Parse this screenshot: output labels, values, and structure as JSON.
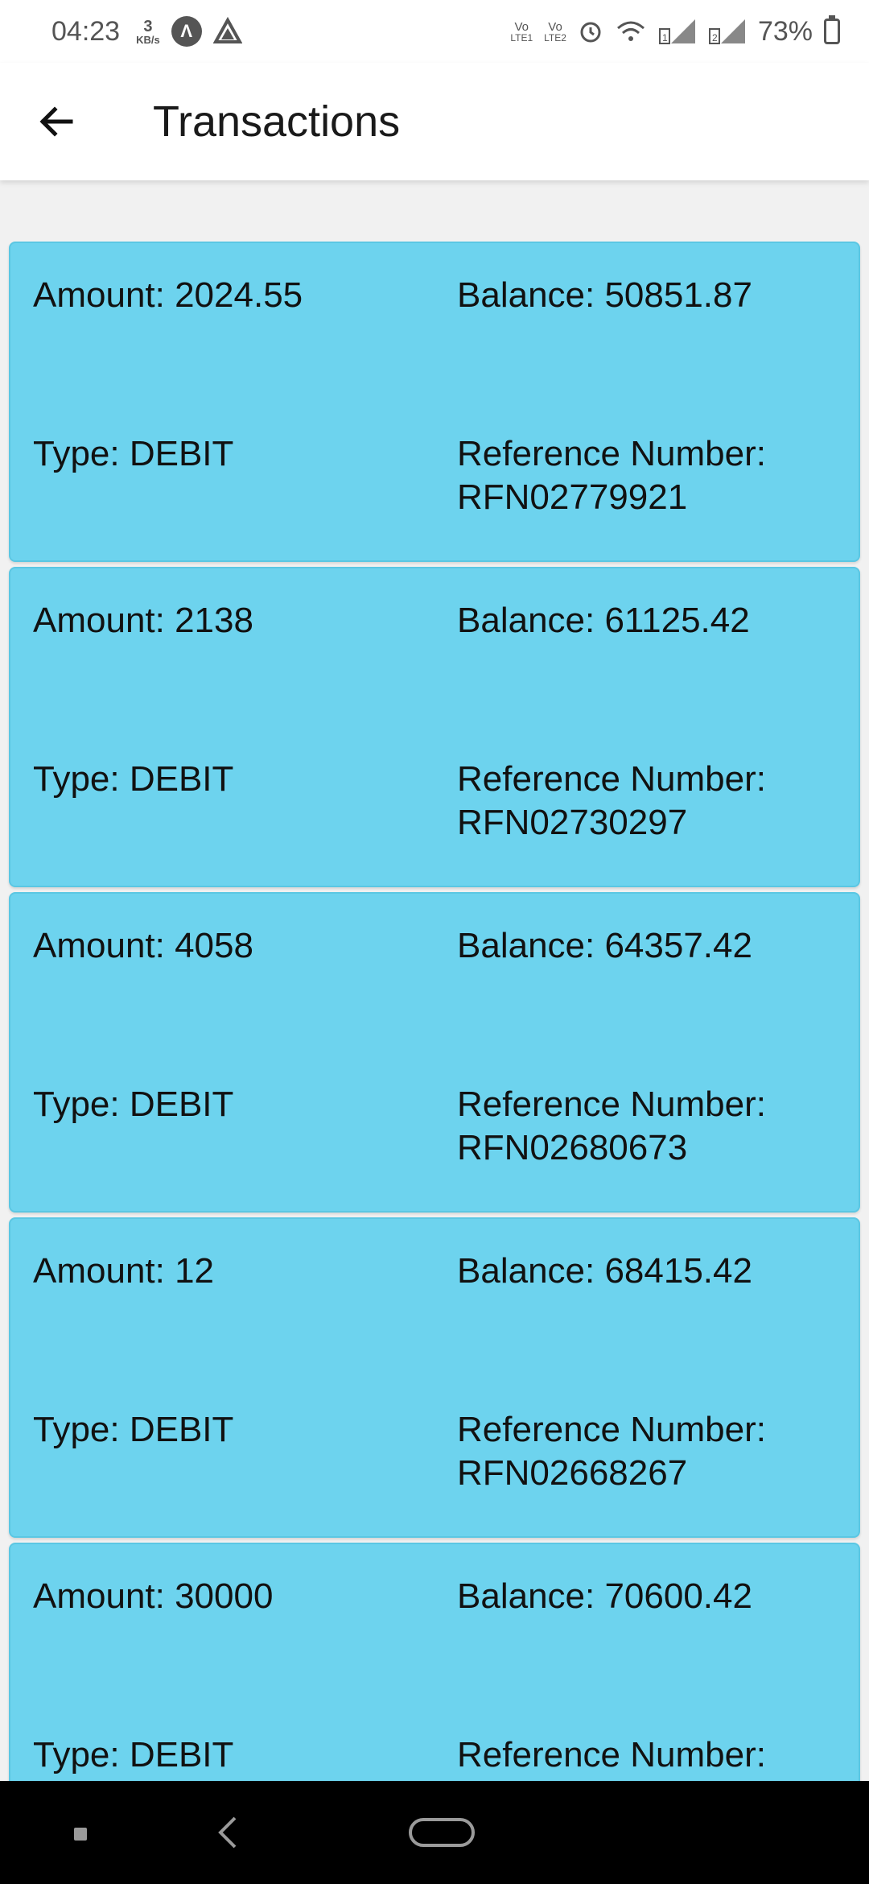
{
  "status_bar": {
    "time": "04:23",
    "net_speed_value": "3",
    "net_speed_unit": "KB/s",
    "volte1": "Vo",
    "volte1_sub": "LTE1",
    "volte2": "Vo",
    "volte2_sub": "LTE2",
    "battery": "73%",
    "icons": [
      "app-a-icon",
      "drive-icon",
      "alarm-icon",
      "wifi-icon",
      "signal-1-icon",
      "signal-2-icon",
      "battery-icon"
    ]
  },
  "app_bar": {
    "title": "Transactions",
    "back_icon": "arrow-left-icon"
  },
  "transactions": [
    {
      "amount": "Amount: 2024.55",
      "balance": "Balance: 50851.87",
      "type": "Type: DEBIT",
      "reference_label": "Reference Number:",
      "reference": "RFN02779921"
    },
    {
      "amount": "Amount: 2138",
      "balance": "Balance: 61125.42",
      "type": "Type: DEBIT",
      "reference_label": "Reference Number:",
      "reference": "RFN02730297"
    },
    {
      "amount": "Amount: 4058",
      "balance": "Balance: 64357.42",
      "type": "Type: DEBIT",
      "reference_label": "Reference Number:",
      "reference": "RFN02680673"
    },
    {
      "amount": "Amount: 12",
      "balance": "Balance: 68415.42",
      "type": "Type: DEBIT",
      "reference_label": "Reference Number:",
      "reference": "RFN02668267"
    },
    {
      "amount": "Amount: 30000",
      "balance": "Balance: 70600.42",
      "type": "Type: DEBIT",
      "reference_label": "Reference Number:",
      "reference": ""
    }
  ],
  "colors": {
    "card": "#6dd3ee",
    "background": "#f1f1f1",
    "nav_bar": "#000000"
  }
}
